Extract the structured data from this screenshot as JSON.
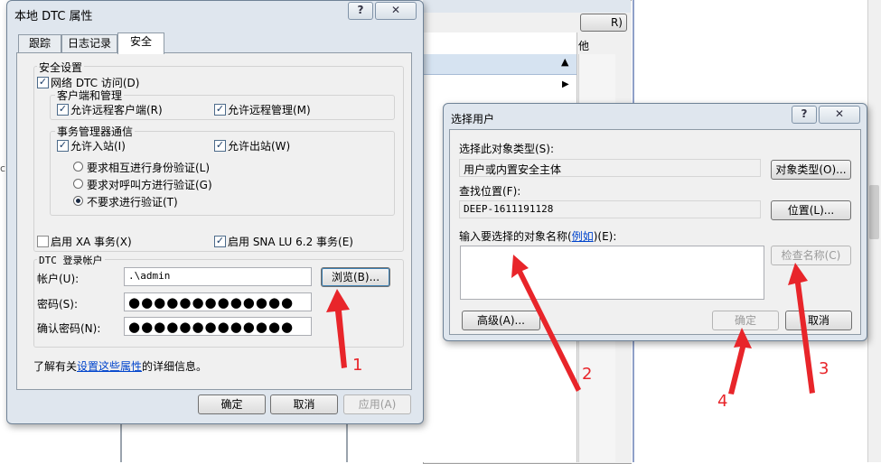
{
  "dtc": {
    "title": "本地 DTC 属性",
    "tabs": [
      "跟踪",
      "日志记录",
      "安全"
    ],
    "security_group": "安全设置",
    "network_access": "网络 DTC 访问(D)",
    "client_admin_group": "客户端和管理",
    "allow_remote_clients": "允许远程客户端(R)",
    "allow_remote_admin": "允许远程管理(M)",
    "tm_comm_group": "事务管理器通信",
    "allow_inbound": "允许入站(I)",
    "allow_outbound": "允许出站(W)",
    "auth_mutual": "要求相互进行身份验证(L)",
    "auth_incoming": "要求对呼叫方进行验证(G)",
    "auth_none": "不要求进行验证(T)",
    "enable_xa": "启用 XA 事务(X)",
    "enable_sna": "启用 SNA LU 6.2 事务(E)",
    "logon_group": "DTC 登录帐户",
    "account_label": "帐户(U):",
    "account_value": ".\\admin",
    "browse_button": "浏览(B)...",
    "password_label": "密码(S):",
    "password_value": "●●●●●●●●●●●●●",
    "confirm_label": "确认密码(N):",
    "confirm_value": "●●●●●●●●●●●●●",
    "learn_prefix": "了解有关",
    "learn_link": "设置这些属性",
    "learn_suffix": "的详细信息。",
    "ok": "确定",
    "cancel": "取消",
    "apply": "应用(A)",
    "help_glyph": "?",
    "close_glyph": "✕"
  },
  "select_user": {
    "title": "选择用户",
    "object_type_label": "选择此对象类型(S):",
    "object_type_value": "用户或内置安全主体",
    "object_type_button": "对象类型(O)...",
    "location_label": "查找位置(F):",
    "location_value": "DEEP-1611191128",
    "location_button": "位置(L)...",
    "enter_names_prefix": "输入要选择的对象名称(",
    "enter_names_link": "例如",
    "enter_names_suffix": ")(E):",
    "check_names_button": "检查名称(C)",
    "advanced_button": "高级(A)...",
    "ok": "确定",
    "cancel": "取消",
    "help_glyph": "?",
    "close_glyph": "✕"
  },
  "background": {
    "r_button": "R)",
    "partial_char": "他"
  },
  "annotations": {
    "n1": "1",
    "n2": "2",
    "n3": "3",
    "n4": "4"
  },
  "colors": {
    "annotation": "#e8252a",
    "link": "#0044cc"
  }
}
